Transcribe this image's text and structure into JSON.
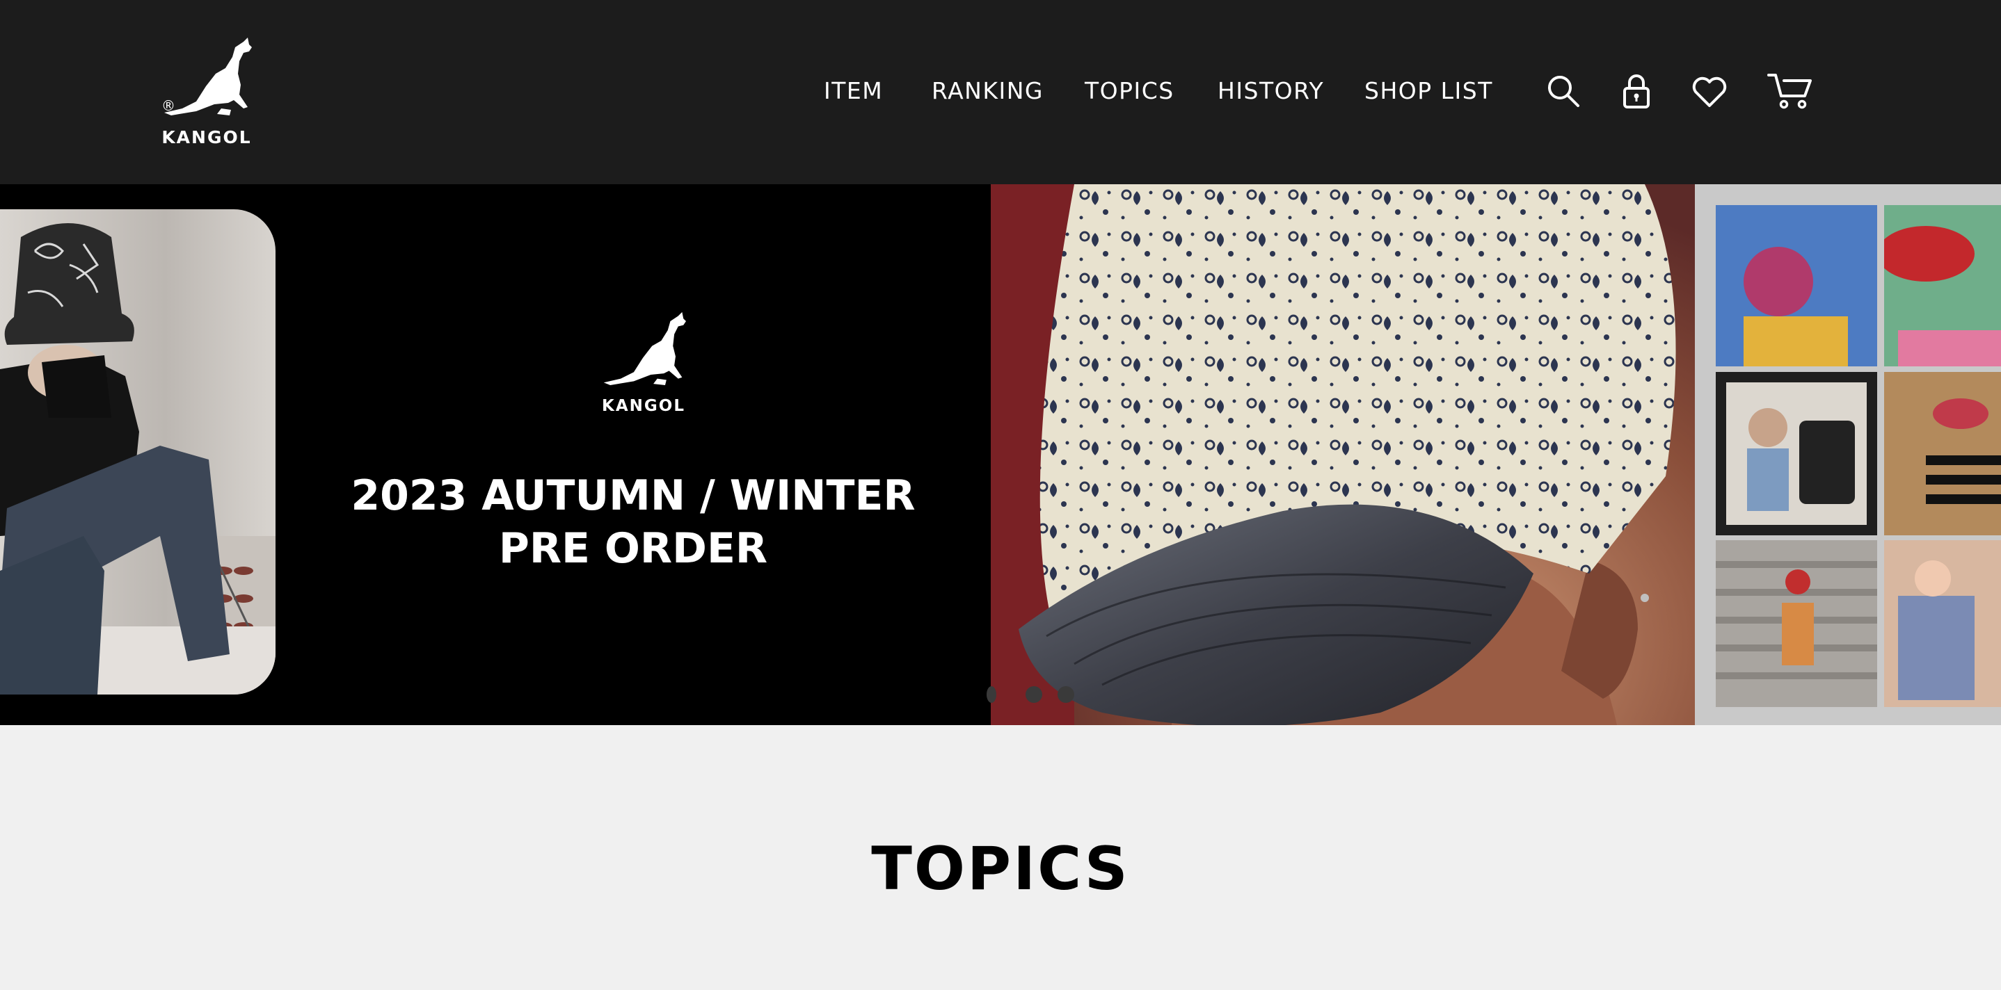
{
  "brand": {
    "logo_text": "KANGOL",
    "registered_mark": "®"
  },
  "nav": {
    "items": [
      {
        "label": "ITEM"
      },
      {
        "label": "RANKING"
      },
      {
        "label": "TOPICS"
      },
      {
        "label": "HISTORY"
      },
      {
        "label": "SHOP LIST"
      }
    ]
  },
  "header_icons": [
    "search-icon",
    "lock-icon",
    "heart-icon",
    "cart-icon"
  ],
  "hero": {
    "promo_logo_text": "KANGOL",
    "promo_line1": "2023 AUTUMN / WINTER",
    "promo_line2": "PRE ORDER",
    "slides": [
      "video-slide",
      "promo-slide",
      "cap-slide",
      "collage-slide"
    ]
  },
  "topics": {
    "title": "TOPICS"
  },
  "colors": {
    "header_bg": "#1c1c1c",
    "hero_bg": "#000000",
    "page_bg": "#f0f0f0",
    "text_light": "#ffffff",
    "text_dark": "#000000"
  }
}
